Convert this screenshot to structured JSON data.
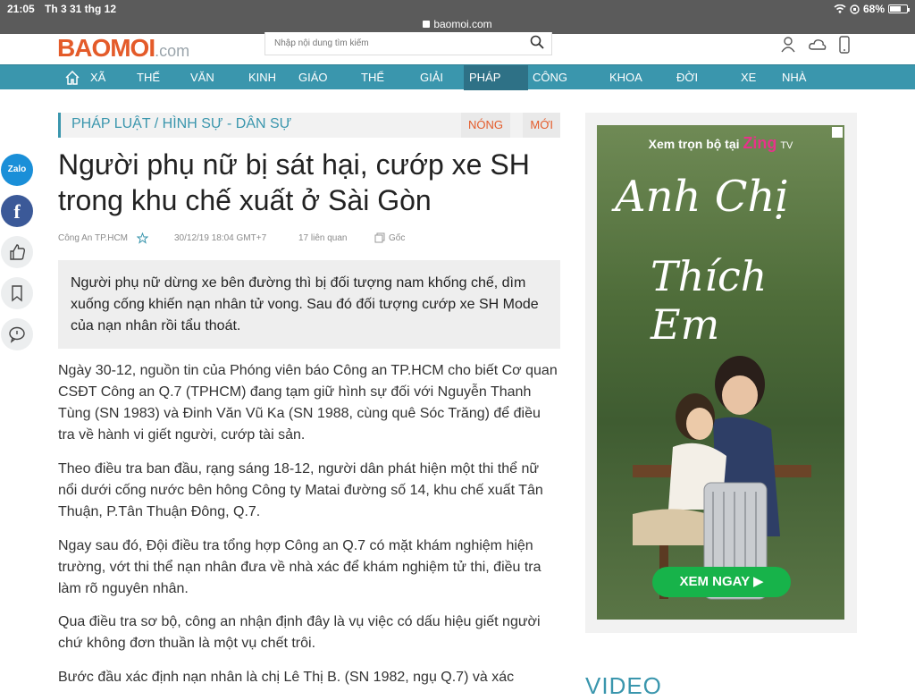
{
  "status": {
    "time": "21:05",
    "date": "Th 3 31 thg 12",
    "battery": "68%",
    "battery_level": 0.68,
    "url": "baomoi.com"
  },
  "header": {
    "logo_main": "BAOMOI",
    "logo_suffix": ".com",
    "search_placeholder": "Nhập nội dung tìm kiếm"
  },
  "nav": [
    "XÃ",
    "THẾ",
    "VĂN",
    "KINH",
    "GIÁO",
    "THỂ",
    "GIẢI",
    "PHÁP",
    "CÔNG",
    "KHOA",
    "ĐỜI",
    "XE",
    "NHÀ"
  ],
  "nav_active": "PHÁP",
  "share": {
    "zalo": "Zalo",
    "facebook": "f"
  },
  "breadcrumb": {
    "text": "PHÁP LUẬT  /  HÌNH SỰ - DÂN SỰ",
    "hot": "NÓNG",
    "new": "MỚI"
  },
  "article": {
    "title": "Người phụ nữ bị sát hại, cướp xe SH trong khu chế xuất ở Sài Gòn",
    "source": "Công An TP.HCM",
    "datetime": "30/12/19 18:04 GMT+7",
    "related": "17 liên quan",
    "original": "Gốc",
    "sapo": "Người phụ nữ dừng xe bên đường thì bị đối tượng nam khống chế, dìm xuống cống khiến nạn nhân tử vong. Sau đó đối tượng cướp xe SH Mode của nạn nhân rồi tẩu thoát.",
    "paragraphs": [
      "Ngày 30-12, nguồn tin của Phóng viên báo Công an TP.HCM cho biết Cơ quan CSĐT Công an Q.7 (TPHCM) đang tạm giữ hình sự đối với Nguyễn Thanh Tùng (SN 1983) và Đinh Văn Vũ Ka (SN 1988, cùng quê Sóc Trăng) để điều tra về hành vi giết người, cướp tài sản.",
      "Theo điều tra ban đầu, rạng sáng 18-12, người dân phát hiện một thi thể nữ nổi dưới cống nước bên hông Công ty Matai đường số 14, khu chế xuất Tân Thuận, P.Tân Thuận Đông, Q.7.",
      "Ngay sau đó, Đội điều tra tổng hợp Công an Q.7 có mặt khám nghiệm hiện trường, vớt thi thể nạn nhân đưa về nhà xác để khám nghiệm tử thi, điều tra làm rõ nguyên nhân.",
      "Qua điều tra sơ bộ, công an nhận định đây là vụ việc có dấu hiệu giết người chứ không đơn thuần là một vụ chết trôi.",
      "Bước đầu xác định nạn nhân là chị Lê Thị B. (SN 1982, ngụ Q.7) và xác"
    ]
  },
  "ad": {
    "top_text": "Xem trọn bộ tại",
    "brand": "Zing",
    "brand_suffix": "TV",
    "title_line1": "Anh Chị",
    "title_line2": "Thích Em",
    "cta": "XEM NGAY ▶"
  },
  "sidebar": {
    "video_heading": "VIDEO"
  }
}
